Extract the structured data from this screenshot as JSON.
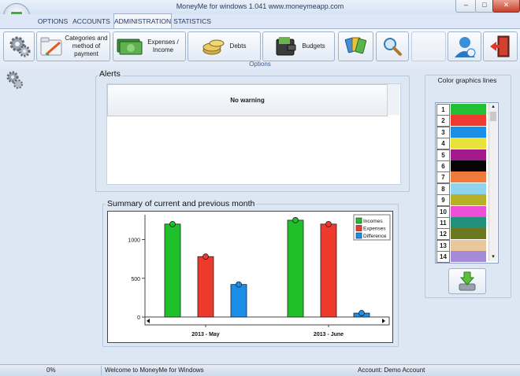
{
  "window": {
    "title": "MoneyMe for windows 1.041 www.moneymeapp.com"
  },
  "menu_tabs": [
    {
      "label": "OPTIONS"
    },
    {
      "label": "ACCOUNTS"
    },
    {
      "label": "ADMINISTRATION"
    },
    {
      "label": "STATISTICS"
    }
  ],
  "ribbon": {
    "caption": "Options",
    "buttons": {
      "settings": {
        "icon": "gears-icon"
      },
      "categories": {
        "label": "Categories and method of payment",
        "icon": "folder-pen-icon"
      },
      "expenses_income": {
        "label": "Expenses / Income",
        "icon": "money-icon"
      },
      "debts": {
        "label": "Debts",
        "icon": "coins-icon"
      },
      "budgets": {
        "label": "Budgets",
        "icon": "wallet-icon"
      },
      "cards": {
        "icon": "cards-icon"
      },
      "search": {
        "icon": "magnifier-icon"
      },
      "user": {
        "icon": "user-icon"
      },
      "exit": {
        "icon": "exit-door-icon"
      }
    }
  },
  "alerts": {
    "title": "Alerts",
    "message": "No warning"
  },
  "summary": {
    "title": "Summary of current and previous month"
  },
  "colors_panel": {
    "title": "Color graphics lines",
    "lines": [
      {
        "n": "1",
        "color": "#22c032"
      },
      {
        "n": "2",
        "color": "#ee3a31"
      },
      {
        "n": "3",
        "color": "#1b8ee8"
      },
      {
        "n": "4",
        "color": "#e8e23a"
      },
      {
        "n": "5",
        "color": "#a3198e"
      },
      {
        "n": "6",
        "color": "#050505"
      },
      {
        "n": "7",
        "color": "#f07a3a"
      },
      {
        "n": "8",
        "color": "#8fd3ee"
      },
      {
        "n": "9",
        "color": "#b5b22a"
      },
      {
        "n": "10",
        "color": "#ec4fd8"
      },
      {
        "n": "11",
        "color": "#23907a"
      },
      {
        "n": "12",
        "color": "#6b7820"
      },
      {
        "n": "13",
        "color": "#e7c79b"
      },
      {
        "n": "14",
        "color": "#a48ad9"
      }
    ]
  },
  "status": {
    "progress": "0%",
    "welcome": "Welcome to MoneyMe for Windows",
    "account": "Account: Demo Account"
  },
  "chart_data": {
    "type": "bar",
    "categories": [
      "2013 - May",
      "2013 - June"
    ],
    "series": [
      {
        "name": "Incomes",
        "color": "#1fc02a",
        "values": [
          1200,
          1250
        ]
      },
      {
        "name": "Expenses",
        "color": "#ee3a2d",
        "values": [
          780,
          1200
        ]
      },
      {
        "name": "Difference",
        "color": "#1b8ee8",
        "values": [
          420,
          50
        ]
      }
    ],
    "yticks": [
      0,
      500,
      1000
    ],
    "ylim": [
      0,
      1300
    ],
    "legend": "top-right"
  }
}
